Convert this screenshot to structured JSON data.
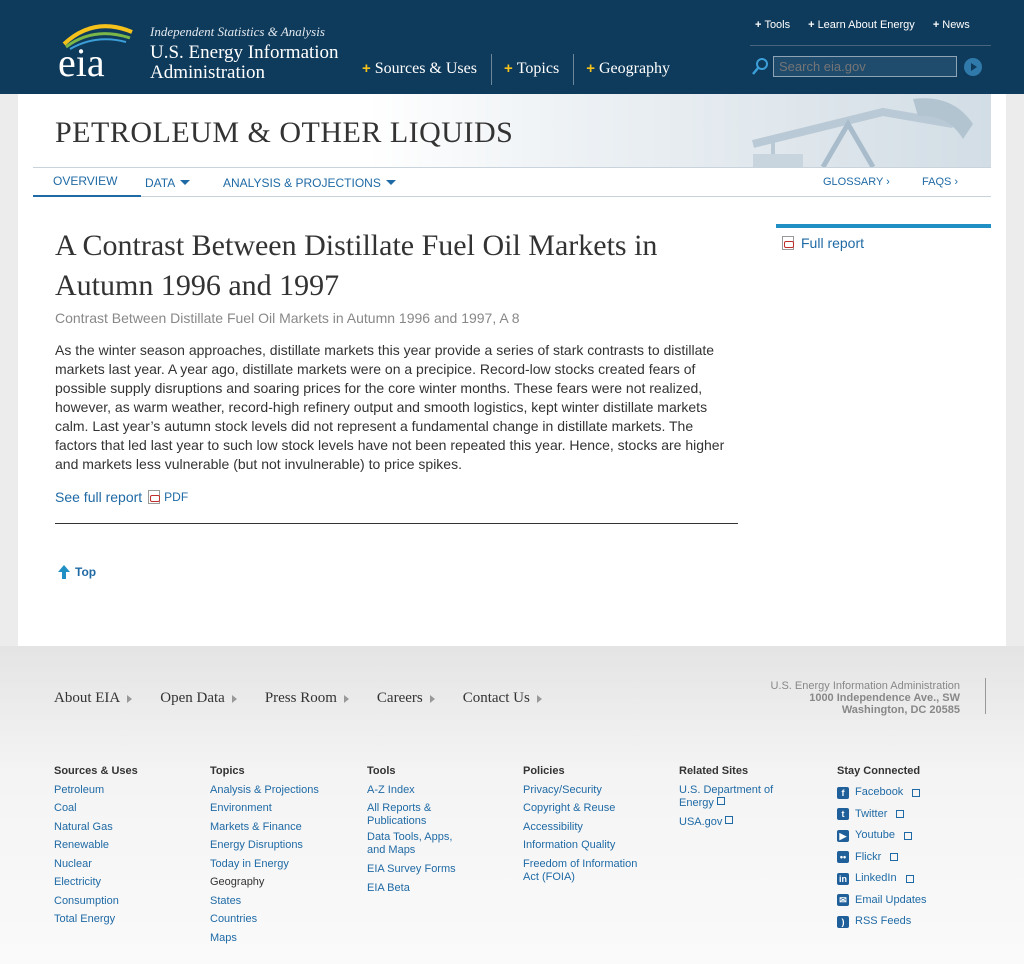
{
  "header": {
    "tagline": "Independent Statistics & Analysis",
    "name_line1": "U.S. Energy Information",
    "name_line2": "Administration",
    "logo_text": "eia",
    "nav": [
      "Sources & Uses",
      "Topics",
      "Geography"
    ],
    "top_links": [
      "Tools",
      "Learn About Energy",
      "News"
    ],
    "search_placeholder": "Search eia.gov"
  },
  "section": {
    "title": "PETROLEUM & OTHER LIQUIDS",
    "subnav": {
      "overview": "OVERVIEW",
      "data": "DATA",
      "analysis": "ANALYSIS & PROJECTIONS",
      "glossary": "GLOSSARY ›",
      "faqs": "FAQS ›"
    }
  },
  "article": {
    "title": "A Contrast Between Distillate Fuel Oil Markets in Autumn 1996 and 1997",
    "subtitle": "Contrast Between Distillate Fuel Oil Markets in Autumn 1996 and 1997, A 8",
    "body": "As the winter season approaches, distillate markets this year provide a series of stark contrasts to distillate markets last year. A year ago, distillate markets were on a precipice. Record-low stocks created fears of possible supply disruptions and soaring prices for the core winter months. These fears were not realized, however, as warm weather, record-high refinery output and smooth logistics, kept winter distillate markets calm. Last year’s autumn stock levels did not represent a fundamental change in distillate markets. The factors that led last year to such low stock levels have not been repeated this year. Hence, stocks are higher and markets less vulnerable (but not invulnerable) to price spikes.",
    "full_report_link": "See full report",
    "pdf_label": "PDF",
    "top_link": "Top"
  },
  "sidebar": {
    "full_report": "Full report"
  },
  "footer": {
    "nav": [
      "About EIA",
      "Open Data",
      "Press Room",
      "Careers",
      "Contact Us"
    ],
    "address": [
      "U.S. Energy Information Administration",
      "1000 Independence Ave., SW",
      "Washington, DC 20585"
    ],
    "columns": {
      "sources": {
        "heading": "Sources & Uses",
        "links": [
          "Petroleum",
          "Coal",
          "Natural Gas",
          "Renewable",
          "Nuclear",
          "Electricity",
          "Consumption",
          "Total Energy"
        ]
      },
      "topics": {
        "heading": "Topics",
        "links": [
          "Analysis & Projections",
          "Environment",
          "Markets & Finance",
          "Energy Disruptions",
          "Today in Energy"
        ],
        "geo_heading": "Geography",
        "geo_links": [
          "States",
          "Countries",
          "Maps"
        ]
      },
      "tools": {
        "heading": "Tools",
        "links": [
          "A-Z Index",
          "All Reports & Publications",
          "Data Tools, Apps, and Maps",
          "EIA Survey Forms",
          "EIA Beta"
        ]
      },
      "policies": {
        "heading": "Policies",
        "links": [
          "Privacy/Security",
          "Copyright & Reuse",
          "Accessibility",
          "Information Quality",
          "Freedom of Information Act (FOIA)"
        ]
      },
      "related": {
        "heading": "Related Sites",
        "links": [
          "U.S. Department of Energy",
          "USA.gov"
        ]
      },
      "social": {
        "heading": "Stay Connected",
        "links": [
          "Facebook",
          "Twitter",
          "Youtube",
          "Flickr",
          "LinkedIn",
          "Email Updates",
          "RSS Feeds"
        ]
      }
    }
  },
  "colors": {
    "header_bg": "#0e3a5b",
    "link": "#1f6aa5",
    "accent": "#f5c21b"
  }
}
